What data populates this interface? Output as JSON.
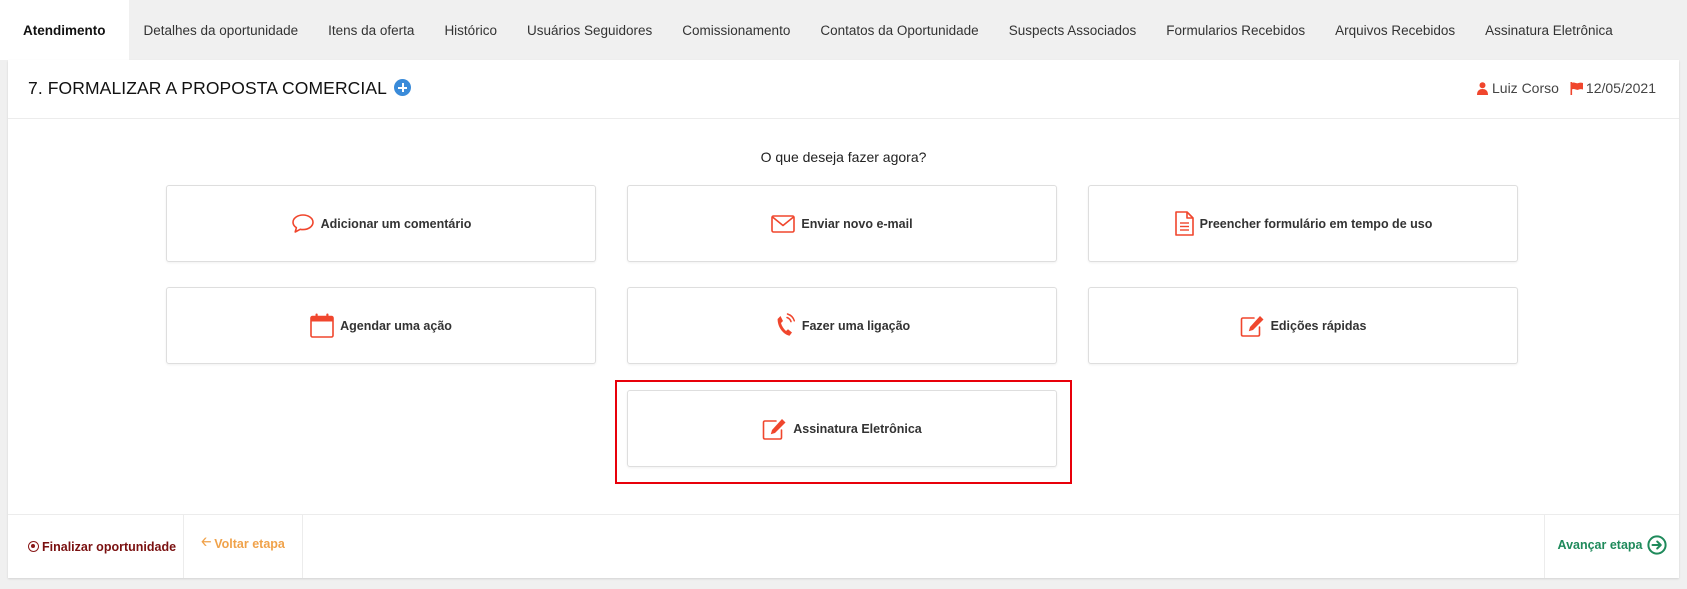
{
  "tabs": [
    {
      "label": "Atendimento",
      "active": true
    },
    {
      "label": "Detalhes da oportunidade"
    },
    {
      "label": "Itens da oferta"
    },
    {
      "label": "Histórico"
    },
    {
      "label": "Usuários Seguidores"
    },
    {
      "label": "Comissionamento"
    },
    {
      "label": "Contatos da Oportunidade"
    },
    {
      "label": "Suspects Associados"
    },
    {
      "label": "Formularios Recebidos"
    },
    {
      "label": "Arquivos Recebidos"
    },
    {
      "label": "Assinatura Eletrônica"
    }
  ],
  "stage": {
    "title": "7. FORMALIZAR A PROPOSTA COMERCIAL",
    "owner": "Luiz Corso",
    "date": "12/05/2021"
  },
  "prompt": "O que deseja fazer agora?",
  "actions": {
    "comment": {
      "label": "Adicionar um comentário",
      "icon": "comment-icon"
    },
    "email": {
      "label": "Enviar novo e-mail",
      "icon": "envelope-icon"
    },
    "form": {
      "label": "Preencher formulário em tempo de uso",
      "icon": "document-icon"
    },
    "schedule": {
      "label": "Agendar uma ação",
      "icon": "calendar-icon"
    },
    "call": {
      "label": "Fazer uma ligação",
      "icon": "phone-icon"
    },
    "quick_edit": {
      "label": "Edições rápidas",
      "icon": "edit-icon"
    },
    "signature": {
      "label": "Assinatura Eletrônica",
      "icon": "edit-icon"
    }
  },
  "footer": {
    "finish": "Finalizar oportunidade",
    "back": "Voltar etapa",
    "next": "Avançar etapa"
  },
  "colors": {
    "accent": "#f0462d",
    "highlight": "#e8000a",
    "finish": "#7a1010",
    "back": "#f0a24a",
    "next": "#1f8a5b",
    "add": "#3a8bd9"
  }
}
